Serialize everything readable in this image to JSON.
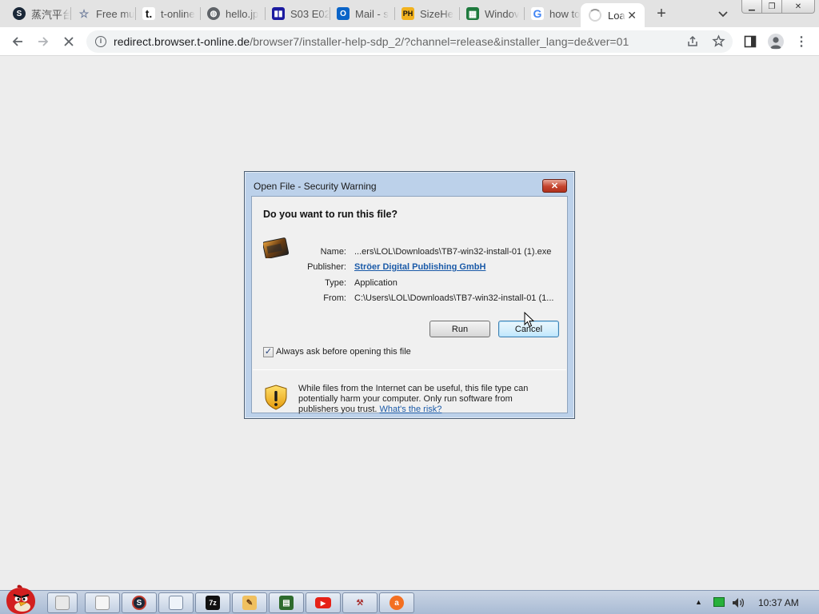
{
  "browser": {
    "tabs": [
      {
        "title": "蒸汽平台",
        "favicon": "steam-icon",
        "color": "#1b2838"
      },
      {
        "title": "Free mu",
        "favicon": "star-outline-icon",
        "color": "#6b7a99"
      },
      {
        "title": "t-online",
        "favicon": "t-online-icon",
        "color": "#ffffff"
      },
      {
        "title": "hello.jp",
        "favicon": "globe-icon",
        "color": "#5f6368"
      },
      {
        "title": "S03 E02",
        "favicon": "tv-icon",
        "color": "#1b1aa0"
      },
      {
        "title": "Mail - s",
        "favicon": "outlook-icon",
        "color": "#0a64c8"
      },
      {
        "title": "SizeHe",
        "favicon": "ph-icon",
        "color": "#f2b21e"
      },
      {
        "title": "Windov",
        "favicon": "sheet-icon",
        "color": "#1e7a3d"
      },
      {
        "title": "how to",
        "favicon": "google-icon",
        "color": "#4285f4"
      },
      {
        "title": "Loa",
        "favicon": "loading-spinner-icon",
        "color": "#9a9a9a",
        "active": true
      }
    ],
    "url_host": "redirect.browser.t-online.de",
    "url_path": "/browser7/installer-help-sdp_2/?channel=release&installer_lang=de&ver=01"
  },
  "dialog": {
    "title": "Open File - Security Warning",
    "question": "Do you want to run this file?",
    "fields": [
      {
        "label": "Name:",
        "value": "...ers\\LOL\\Downloads\\TB7-win32-install-01 (1).exe"
      },
      {
        "label": "Publisher:",
        "value": "Ströer Digital Publishing GmbH"
      },
      {
        "label": "Type:",
        "value": "Application"
      },
      {
        "label": "From:",
        "value": "C:\\Users\\LOL\\Downloads\\TB7-win32-install-01 (1..."
      }
    ],
    "run_label": "Run",
    "cancel_label": "Cancel",
    "checkbox_label": "Always ask before opening this file",
    "checkbox_checked": true,
    "warning_text": "While files from the Internet can be useful, this file type can potentially harm your computer. Only run software from publishers you trust.",
    "risk_link": "What's the risk?"
  },
  "taskbar": {
    "apps": [
      "file-explorer-icon",
      "notepad-icon",
      "steam-icon",
      "document-icon",
      "7zip-icon",
      "pencil-icon",
      "gpu-monitor-icon",
      "youtube-icon",
      "tool-icon",
      "avast-icon"
    ],
    "time": "10:37 AM"
  }
}
